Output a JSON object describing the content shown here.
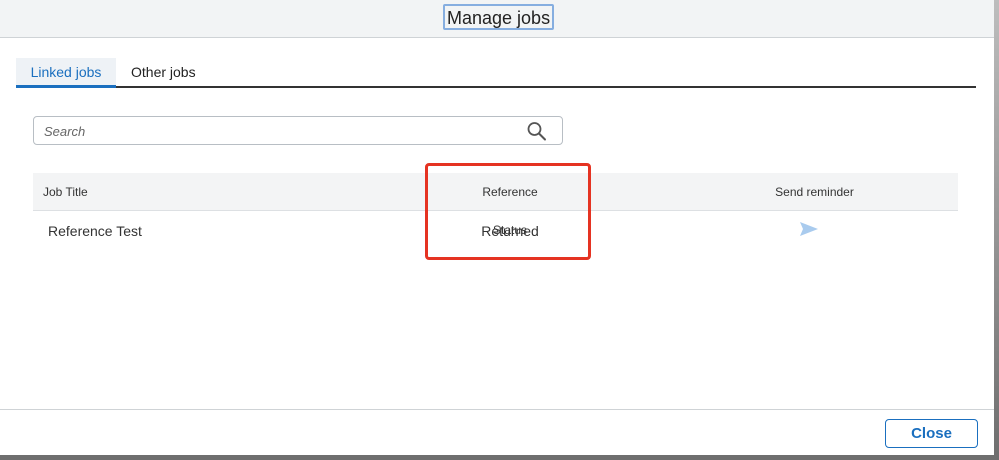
{
  "dialog": {
    "title": "Manage jobs"
  },
  "tabs": [
    {
      "label": "Linked jobs",
      "active": true
    },
    {
      "label": "Other jobs",
      "active": false
    }
  ],
  "search": {
    "placeholder": "Search",
    "value": ""
  },
  "table": {
    "columns": [
      "Job Title",
      "Reference Status",
      "Send reminder"
    ],
    "rows": [
      {
        "job_title": "Reference Test",
        "reference_status": "Returned",
        "send_reminder_icon": "send-icon"
      }
    ]
  },
  "footer": {
    "close_label": "Close"
  },
  "colors": {
    "accent": "#1a6fbf",
    "highlight": "#e53322",
    "send_icon": "#a9cbee"
  }
}
